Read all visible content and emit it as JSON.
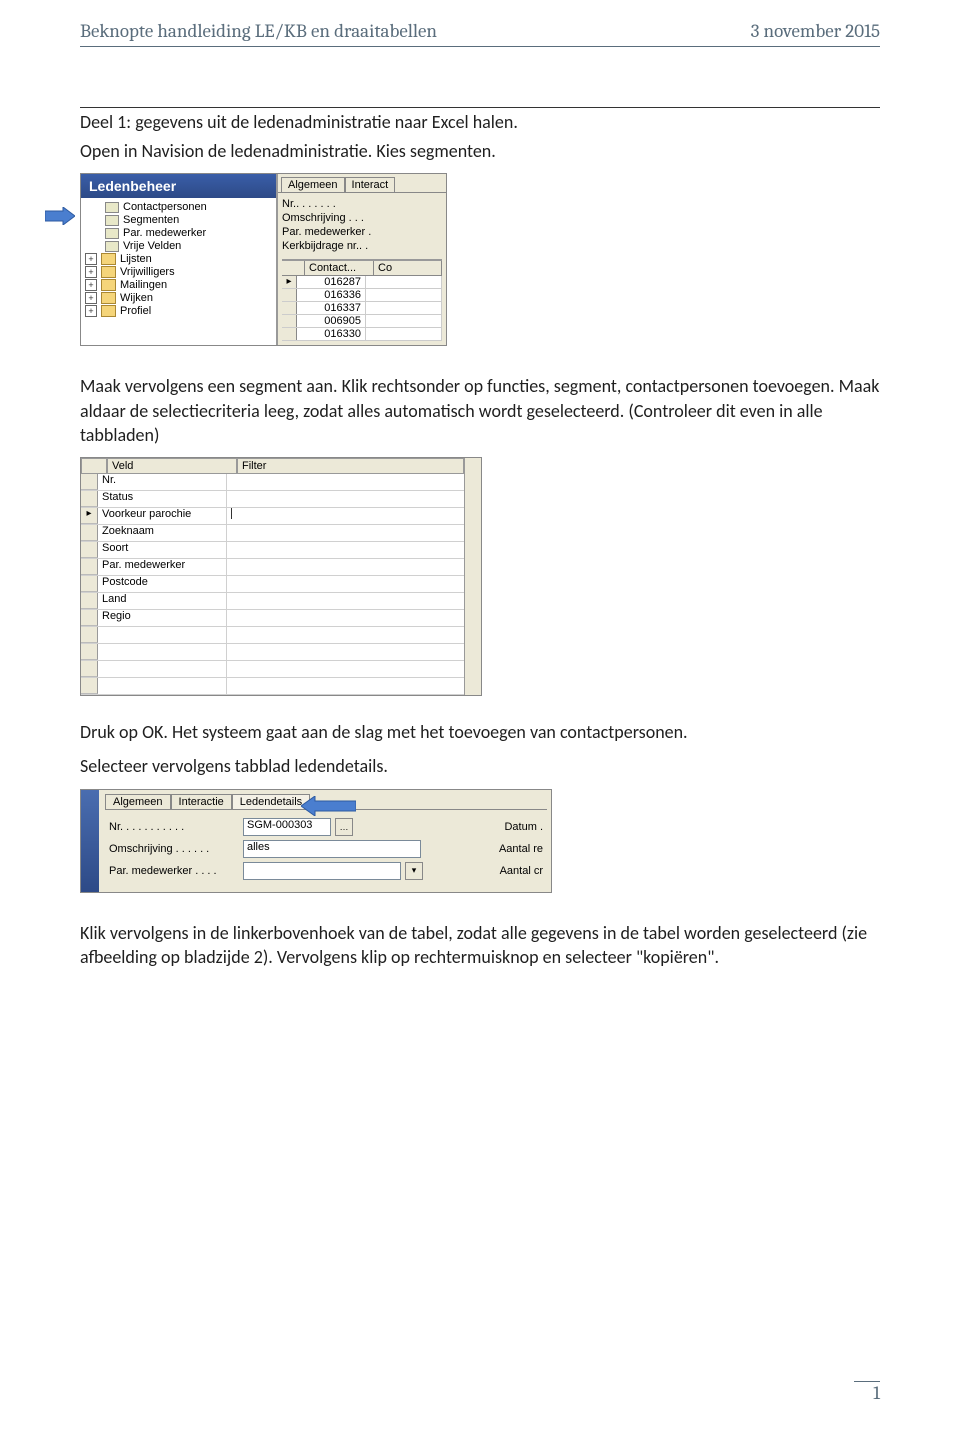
{
  "header": {
    "title_left": "Beknopte handleiding LE/KB en draaitabellen",
    "title_right": "3 november 2015"
  },
  "section_title": "Deel 1: gegevens uit de ledenadministratie naar Excel halen.",
  "para1": "Open in Navision de ledenadministratie. Kies segmenten.",
  "shot1": {
    "title": "Ledenbeheer",
    "tree": [
      "Contactpersonen",
      "Segmenten",
      "Par. medewerker",
      "Vrije Velden",
      "Lijsten",
      "Vrijwilligers",
      "Mailingen",
      "Wijken",
      "Profiel"
    ],
    "tabs": [
      "Algemeen",
      "Interact"
    ],
    "fields": [
      {
        "label": "Nr.",
        "dots": ". . . . . . ."
      },
      {
        "label": "Omschrijving",
        "dots": ". . ."
      },
      {
        "label": "Par. medewerker",
        "dots": "."
      },
      {
        "label": "Kerkbijdrage nr.",
        "dots": ". ."
      }
    ],
    "grid_head": [
      "Contact...",
      "Co"
    ],
    "grid_rows": [
      "016287",
      "016336",
      "016337",
      "006905",
      "016330"
    ]
  },
  "para2": "Maak vervolgens een segment aan. Klik rechtsonder op functies, segment, contactpersonen toevoegen. Maak aldaar de selectiecriteria leeg, zodat alles automatisch wordt geselecteerd. (Controleer dit even in alle tabbladen)",
  "shot2": {
    "headers": [
      "Veld",
      "Filter"
    ],
    "rows": [
      "Nr.",
      "Status",
      "Voorkeur parochie",
      "Zoeknaam",
      "Soort",
      "Par. medewerker",
      "Postcode",
      "Land",
      "Regio",
      "",
      "",
      "",
      ""
    ]
  },
  "para3": "Druk op OK. Het systeem gaat aan de slag met het toevoegen van contactpersonen.",
  "para4": "Selecteer vervolgens tabblad ledendetails.",
  "shot3": {
    "tabs": [
      "Algemeen",
      "Interactie",
      "Ledendetails"
    ],
    "fields": {
      "nr_label": "Nr. . . . . . . . . . .",
      "nr_value": "SGM-000303",
      "oms_label": "Omschrijving . . . . . .",
      "oms_value": "alles",
      "pm_label": "Par. medewerker . . . .",
      "right1": "Datum .",
      "right2": "Aantal re",
      "right3": "Aantal cr"
    }
  },
  "para5": "Klik vervolgens in de linkerbovenhoek van de tabel, zodat alle gegevens in de tabel worden geselecteerd (zie afbeelding op bladzijde 2). Vervolgens klip op rechtermuisknop en selecteer \"kopiëren\".",
  "page_number": "1"
}
